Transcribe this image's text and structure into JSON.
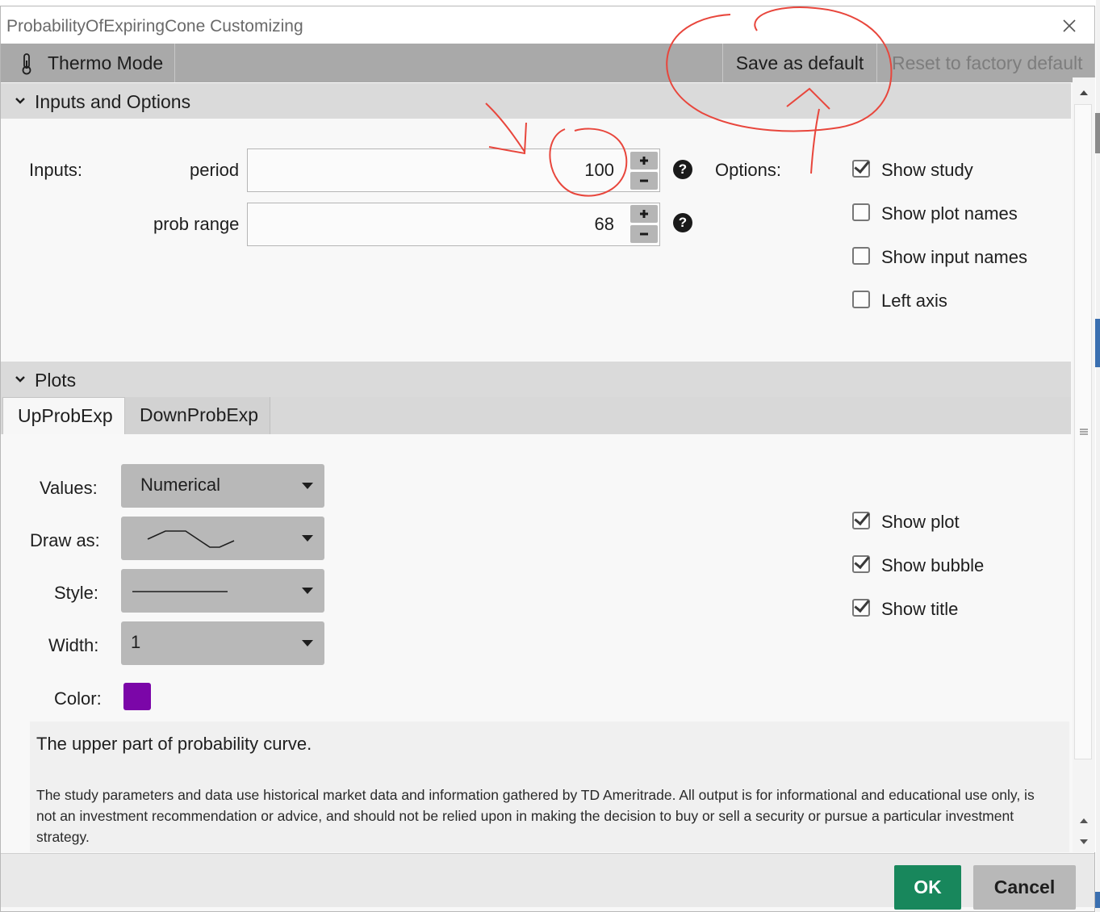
{
  "window": {
    "title": "ProbabilityOfExpiringCone Customizing",
    "close_icon": "close-icon"
  },
  "toolbar": {
    "thermo_mode_label": "Thermo Mode",
    "thermo_icon": "thermometer-icon",
    "save_default_label": "Save as default",
    "reset_factory_label": "Reset to factory default"
  },
  "inputs_section": {
    "header": "Inputs and Options",
    "inputs_label": "Inputs:",
    "options_label": "Options:",
    "fields": [
      {
        "label": "period",
        "value": "100"
      },
      {
        "label": "prob range",
        "value": "68"
      }
    ],
    "stepper_plus": "+",
    "stepper_minus": "−",
    "help_glyph": "?",
    "options": [
      {
        "label": "Show study",
        "checked": true
      },
      {
        "label": "Show plot names",
        "checked": false
      },
      {
        "label": "Show input names",
        "checked": false
      },
      {
        "label": "Left axis",
        "checked": false
      }
    ]
  },
  "plots_section": {
    "header": "Plots",
    "tabs": [
      {
        "label": "UpProbExp",
        "active": true
      },
      {
        "label": "DownProbExp",
        "active": false
      }
    ],
    "values_label": "Values:",
    "values_selected": "Numerical",
    "draw_as_label": "Draw as:",
    "draw_as_icon": "line-chart-icon",
    "style_label": "Style:",
    "style_icon": "solid-line-icon",
    "width_label": "Width:",
    "width_selected": "1",
    "color_label": "Color:",
    "color_value": "#7b06a8",
    "options": [
      {
        "label": "Show plot",
        "checked": true
      },
      {
        "label": "Show bubble",
        "checked": true
      },
      {
        "label": "Show title",
        "checked": true
      }
    ]
  },
  "description": {
    "main": "The upper part of probability curve.",
    "disclaimer": "The study parameters and data use historical market data and information gathered by TD Ameritrade. All output is for informational and educational use only, is not an investment recommendation or advice, and should not be relied upon in making the decision to buy or sell a security or pursue a particular investment strategy."
  },
  "footer": {
    "ok_label": "OK",
    "cancel_label": "Cancel"
  },
  "colors": {
    "ok_green": "#18875c",
    "toolbar_gray": "#a9a9a9",
    "annotation_red": "#e8463c"
  }
}
